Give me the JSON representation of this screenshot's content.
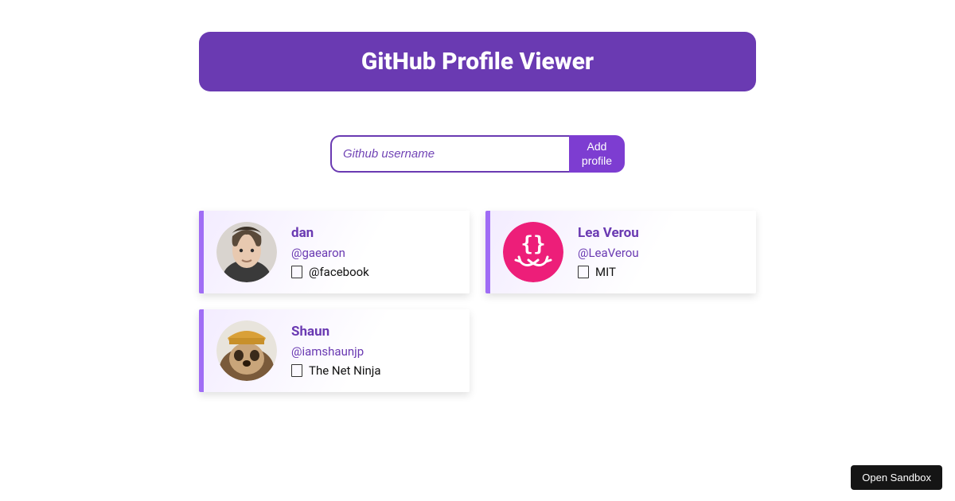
{
  "header": {
    "title": "GitHub Profile Viewer"
  },
  "form": {
    "placeholder": "Github username",
    "add_label": "Add profile"
  },
  "profiles": [
    {
      "name": "dan",
      "handle": "@gaearon",
      "company": "@facebook"
    },
    {
      "name": "Lea Verou",
      "handle": "@LeaVerou",
      "company": "MIT"
    },
    {
      "name": "Shaun",
      "handle": "@iamshaunjp",
      "company": "The Net Ninja"
    }
  ],
  "footer": {
    "sandbox_label": "Open Sandbox"
  }
}
